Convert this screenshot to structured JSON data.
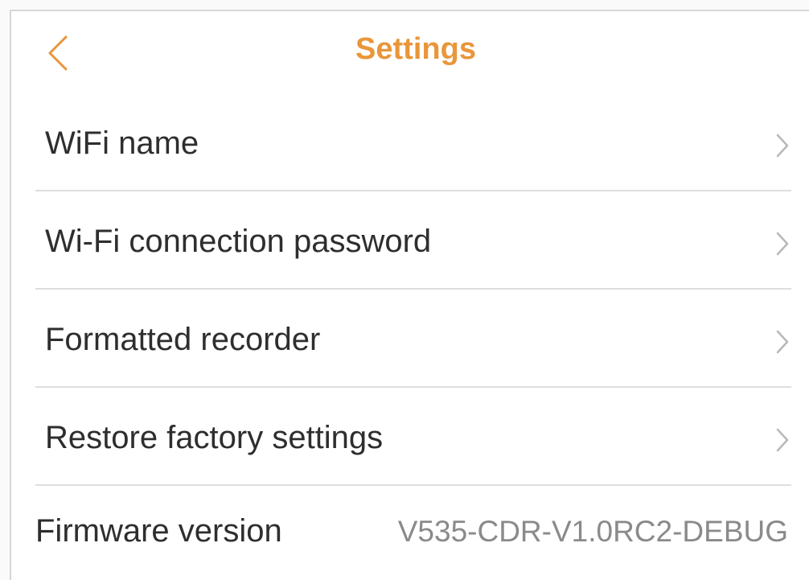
{
  "nav": {
    "title": "Settings",
    "back_icon": "chevron-left-icon",
    "accent_color": "#e9963a"
  },
  "menu": {
    "items": [
      {
        "label": "WiFi name",
        "icon": "chevron-right-icon"
      },
      {
        "label": "Wi-Fi connection password",
        "icon": "chevron-right-icon"
      },
      {
        "label": "Formatted recorder",
        "icon": "chevron-right-icon"
      },
      {
        "label": "Restore factory settings",
        "icon": "chevron-right-icon"
      }
    ]
  },
  "firmware": {
    "label": "Firmware version",
    "value": "V535-CDR-V1.0RC2-DEBUG"
  }
}
